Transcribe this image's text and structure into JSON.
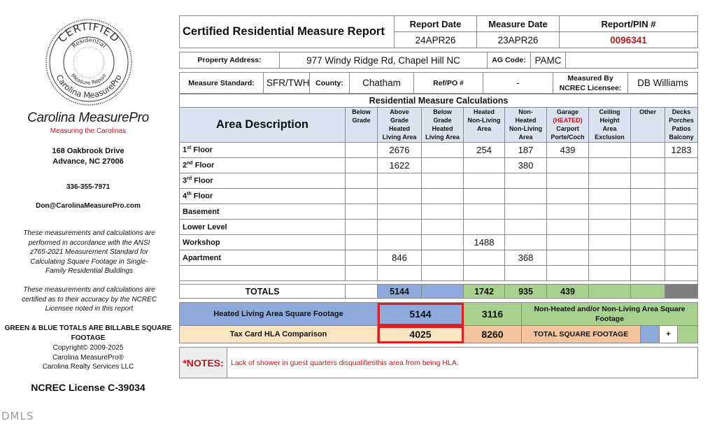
{
  "company": {
    "name": "Carolina MeasurePro",
    "tagline": "Measuring the Carolinas",
    "address_line1": "168 Oakbrook Drive",
    "address_line2": "Advance, NC  27006",
    "phone": "336-355-7971",
    "email": "Don@CarolinaMeasurePro.com",
    "disclaimer1": "These measurements and calculations are performed in accordance with the ANSI z765-2021 Measurement Standard for Calculating Square Footage in Single-Family Residential Buildings",
    "disclaimer2": "These measurements and calculations are certified as to their accuracy by the NCREC Licensee noted in this report",
    "billable_note": "GREEN & BLUE TOTALS ARE BILLABLE SQUARE FOOTAGE",
    "copyright1": "Copyright© 2009-2025",
    "copyright2": "Carolina MeasurePro®",
    "copyright3": "Carolina Realty Services LLC",
    "license": "NCREC License C-39034",
    "seal": {
      "top": "CERTIFIED",
      "inner_top": "Residential",
      "inner_bottom": "Measure Report",
      "bottom": "Carolina MeasurePro"
    }
  },
  "watermark": "DMLS",
  "report": {
    "title": "Certified Residential Measure Report",
    "report_date_label": "Report Date",
    "report_date": "24APR26",
    "measure_date_label": "Measure Date",
    "measure_date": "23APR26",
    "pin_label": "Report/PIN #",
    "pin": "0096341",
    "property_address_label": "Property Address:",
    "property_address": "977 Windy Ridge Rd, Chapel Hill NC",
    "ag_code_label": "AG Code:",
    "ag_code": "PAMC",
    "measure_standard_label": "Measure Standard:",
    "measure_standard": "SFR/TWH",
    "county_label": "County:",
    "county": "Chatham",
    "ref_po_label": "Ref/PO #",
    "ref_po": "-",
    "measured_by_label_1": "Measured By",
    "measured_by_label_2": "NCREC Licensee:",
    "measured_by": "DB Williams"
  },
  "calc": {
    "section_title": "Residential Measure Calculations",
    "area_desc_label": "Area Description",
    "columns": [
      {
        "lines": [
          "Below",
          "Grade"
        ]
      },
      {
        "lines": [
          "Above",
          "Grade",
          "Heated",
          "Living Area"
        ]
      },
      {
        "lines": [
          "Below",
          "Grade",
          "Heated",
          "Living Area"
        ]
      },
      {
        "lines": [
          "Heated",
          "Non-Living",
          "Area"
        ]
      },
      {
        "lines": [
          "Non-",
          "Heated",
          "Non-Living",
          "Area"
        ]
      },
      {
        "lines": [
          "Garage",
          "(HEATED)",
          "Carport",
          "Porte/Coch"
        ]
      },
      {
        "lines": [
          "Ceiling",
          "Height",
          "Area",
          "Exclusion"
        ]
      },
      {
        "lines": [
          "Other"
        ]
      },
      {
        "lines": [
          "Decks",
          "Porches",
          "Patios",
          "Balcony"
        ]
      }
    ],
    "rows": [
      {
        "label": "1",
        "sup": "st",
        "label_rest": " Floor",
        "values": [
          "",
          "2676",
          "",
          "254",
          "187",
          "439",
          "",
          "",
          "1283"
        ]
      },
      {
        "label": "2",
        "sup": "nd",
        "label_rest": " Floor",
        "values": [
          "",
          "1622",
          "",
          "",
          "380",
          "",
          "",
          "",
          ""
        ]
      },
      {
        "label": "3",
        "sup": "rd",
        "label_rest": " Floor",
        "values": [
          "",
          "",
          "",
          "",
          "",
          "",
          "",
          "",
          ""
        ]
      },
      {
        "label": "4",
        "sup": "th",
        "label_rest": " Floor",
        "values": [
          "",
          "",
          "",
          "",
          "",
          "",
          "",
          "",
          ""
        ]
      },
      {
        "label": "Basement",
        "sup": "",
        "label_rest": "",
        "values": [
          "",
          "",
          "",
          "",
          "",
          "",
          "",
          "",
          ""
        ]
      },
      {
        "label": "Lower Level",
        "sup": "",
        "label_rest": "",
        "values": [
          "",
          "",
          "",
          "",
          "",
          "",
          "",
          "",
          ""
        ]
      },
      {
        "label": "Workshop",
        "sup": "",
        "label_rest": "",
        "values": [
          "",
          "",
          "",
          "1488",
          "",
          "",
          "",
          "",
          ""
        ]
      },
      {
        "label": "Apartment",
        "sup": "",
        "label_rest": "",
        "values": [
          "",
          "846",
          "",
          "",
          "368",
          "",
          "",
          "",
          ""
        ]
      },
      {
        "label": "",
        "sup": "",
        "label_rest": "",
        "values": [
          "",
          "",
          "",
          "",
          "",
          "",
          "",
          "",
          ""
        ]
      }
    ],
    "totals_label": "TOTALS",
    "totals": [
      "",
      "5144",
      "",
      "1742",
      "935",
      "439",
      "",
      "",
      ""
    ]
  },
  "summary": {
    "hla_label": "Heated Living Area Square Footage",
    "hla_value": "5144",
    "hla_secondary": "3116",
    "non_heated_label": "Non-Heated and/or Non-Living Area Square Footage",
    "tax_label": "Tax Card HLA Comparison",
    "tax_value": "4025",
    "tax_secondary": "8260",
    "total_sqft_label": "TOTAL SQUARE FOOTAGE",
    "plus": "+"
  },
  "notes": {
    "label": "*NOTES:",
    "text": "Lack of shower in guest quarters disqualifiesthis area from being HLA."
  }
}
